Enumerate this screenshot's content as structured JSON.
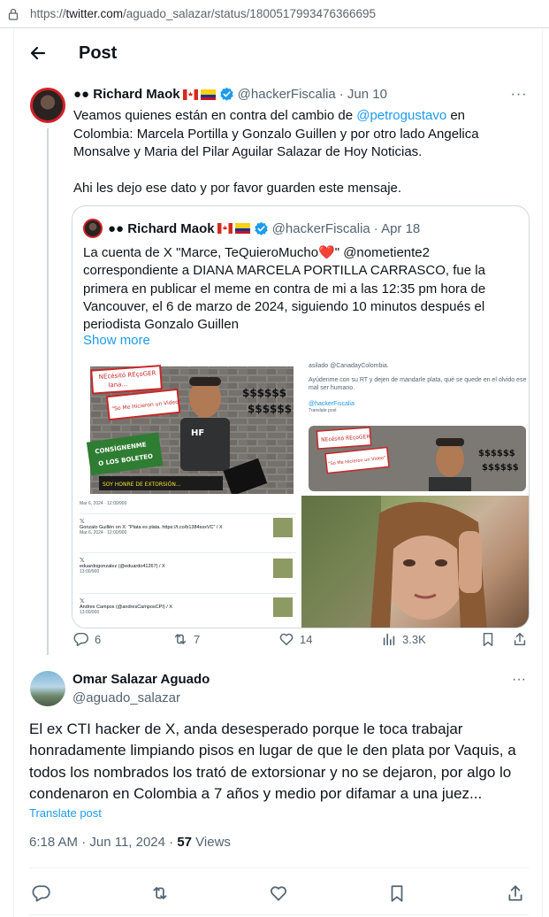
{
  "browser": {
    "url_prefix": "https://",
    "url_domain": "twitter.com",
    "url_path": "/aguado_salazar/status/1800517993476366695"
  },
  "header": {
    "title": "Post"
  },
  "tweet": {
    "display_name": "●● Richard Maok",
    "handle": "@hackerFiscalia",
    "date": "· Jun 10",
    "text_a": "Veamos quienes están en contra del cambio de ",
    "mention": "@petrogustavo",
    "text_b": " en Colombia: Marcela Portilla y Gonzalo Guillen y por otro lado Angelica Monsalve y Maria del Pilar Aguilar Salazar de Hoy Noticias.",
    "text_c": "Ahi les dejo ese dato y por favor guarden este mensaje.",
    "quote": {
      "display_name": "●● Richard Maok",
      "handle": "@hackerFiscalia",
      "date": "· Apr 18",
      "text": "La cuenta de X \"Marce, TeQuieroMucho❤️\" @nometiente2 correspondiente a DIANA MARCELA PORTILLA CARRASCO, fue la primera en publicar el meme en contra de mi a las 12:35 pm hora de Vancouver, el 6 de marzo de 2024, siguiendo 10 minutos después el periodista Gonzalo Guillen",
      "show_more": "Show more",
      "media": {
        "meme_sign_1": "NEcésitó REçoGER",
        "meme_sign_2": "lana...",
        "meme_sign_3": "\"So Me Hicieron un Video\"",
        "meme_money": "$$$$$$",
        "meme_green_1": "CONSÍGNENME",
        "meme_green_2": "O LOS BOLETEO",
        "meme_yellow": "SOY HONRE DE EXTORSIÓN...",
        "meme_hf": "HF",
        "screenshot_line_1": "asilado @CanadayColombia.",
        "screenshot_line_2": "Ayúdenme con su RT y dejen de mandarle plata, qué se quede en el olvido ese mal ser humano.",
        "screenshot_handle": "@hackerFiscalia",
        "screenshot_translate": "Translate post",
        "list_date_top": "Mar 6, 2024 · 12:00/900",
        "list_item_1": "Gonzalo Guillén on X: \"Plata es plata. https://t.co/b1384ssxVC\" / X",
        "list_item_1_date": "Mar 6, 2024 · 12:00/900",
        "list_item_2": "eduardogonzalez (@eduardo41267) / X",
        "list_item_2_date": "13:00/900",
        "list_item_3": "Andres Campos (@andresCamposCPI) / X",
        "list_item_3_date": "13:00/900"
      }
    },
    "replies": "6",
    "reposts": "7",
    "likes": "14",
    "views": "3.3K"
  },
  "reply": {
    "display_name": "Omar Salazar Aguado",
    "handle": "@aguado_salazar",
    "text": "El ex CTI hacker de X, anda desesperado porque le toca trabajar honradamente  limpiando pisos en lugar de que le den plata por Vaquis,  a todos los nombrados los trató de extorsionar y no se dejaron, por algo lo condenaron en Colombia a 7 años y medio por difamar a una juez...",
    "translate": "Translate post",
    "time": "6:18 AM · Jun 11, 2024 · ",
    "views_count": "57",
    "views_label": " Views"
  },
  "more_label": "···",
  "colors": {
    "accent": "#1d9bf0",
    "text": "#0f1419",
    "secondary": "#536471",
    "like": "#f91880",
    "retweet": "#00ba7c"
  }
}
